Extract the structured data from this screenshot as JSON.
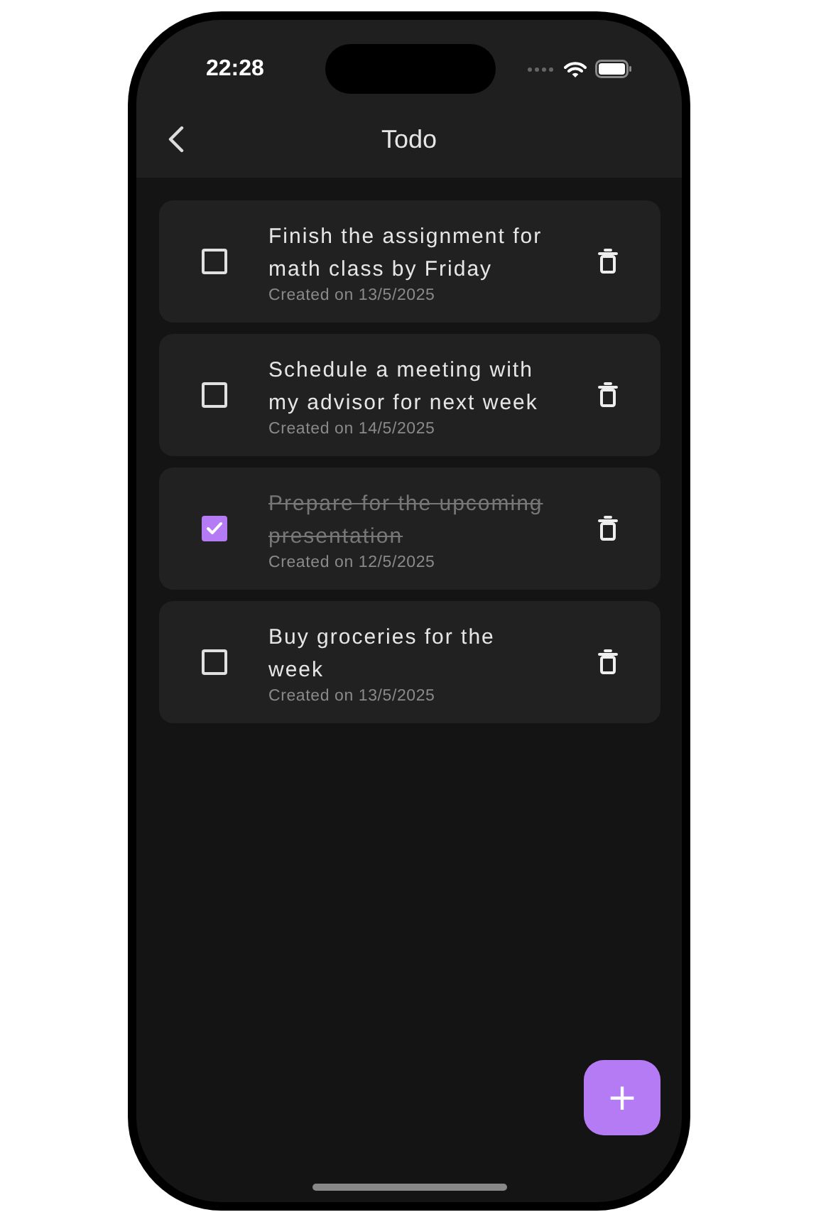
{
  "status_bar": {
    "time": "22:28"
  },
  "app_bar": {
    "title": "Todo"
  },
  "todos": [
    {
      "title": "Finish the assignment for math class by Friday",
      "created": "Created on 13/5/2025",
      "checked": false
    },
    {
      "title": "Schedule a meeting with my advisor for next week",
      "created": "Created on 14/5/2025",
      "checked": false
    },
    {
      "title": "Prepare for the upcoming presentation",
      "created": "Created on 12/5/2025",
      "checked": true
    },
    {
      "title": "Buy groceries for the week",
      "created": "Created on 13/5/2025",
      "checked": false
    }
  ],
  "fab": {
    "label": "+"
  }
}
